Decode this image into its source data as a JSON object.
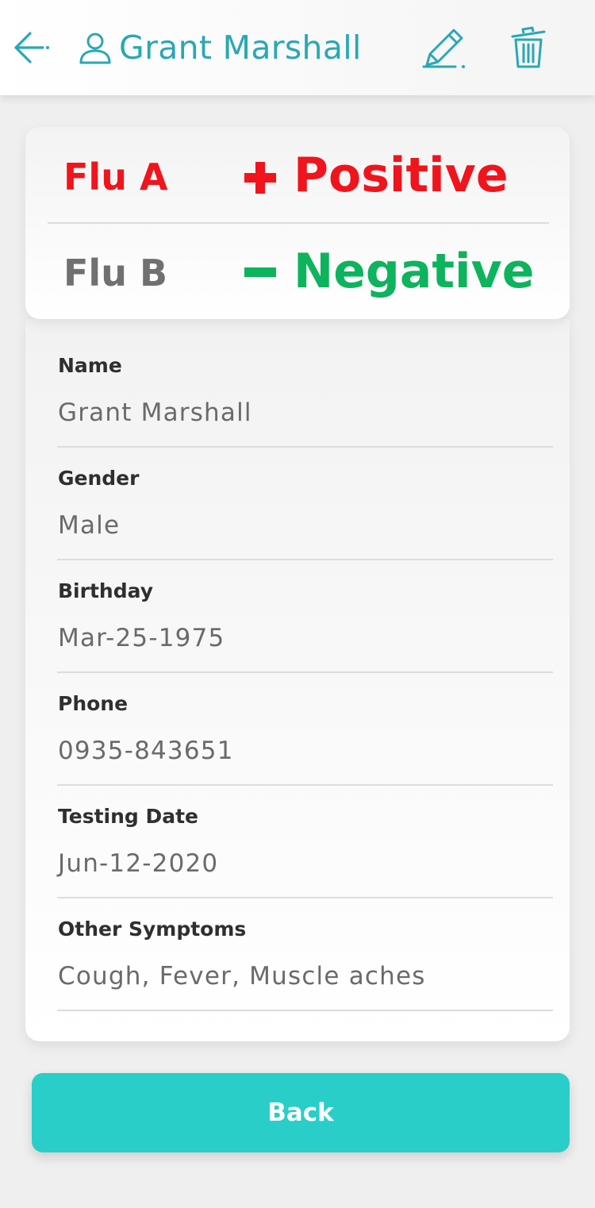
{
  "header": {
    "title": "Grant Marshall",
    "icons": {
      "back": "arrow-left-icon",
      "user": "user-icon",
      "edit": "pencil-icon",
      "delete": "trash-icon"
    },
    "accent_color": "#29a8b4"
  },
  "results": [
    {
      "label": "Flu A",
      "sign": "plus",
      "status": "Positive",
      "label_color": "#f0141d",
      "status_color": "#f0141d"
    },
    {
      "label": "Flu B",
      "sign": "minus",
      "status": "Negative",
      "label_color": "#707070",
      "status_color": "#0db35d"
    }
  ],
  "fields": [
    {
      "label": "Name",
      "value": "Grant Marshall"
    },
    {
      "label": "Gender",
      "value": "Male"
    },
    {
      "label": "Birthday",
      "value": "Mar-25-1975"
    },
    {
      "label": "Phone",
      "value": "0935-843651"
    },
    {
      "label": "Testing Date",
      "value": "Jun-12-2020"
    },
    {
      "label": "Other Symptoms",
      "value": "Cough, Fever, Muscle aches"
    }
  ],
  "back_button": {
    "label": "Back",
    "color": "#29cec9"
  }
}
